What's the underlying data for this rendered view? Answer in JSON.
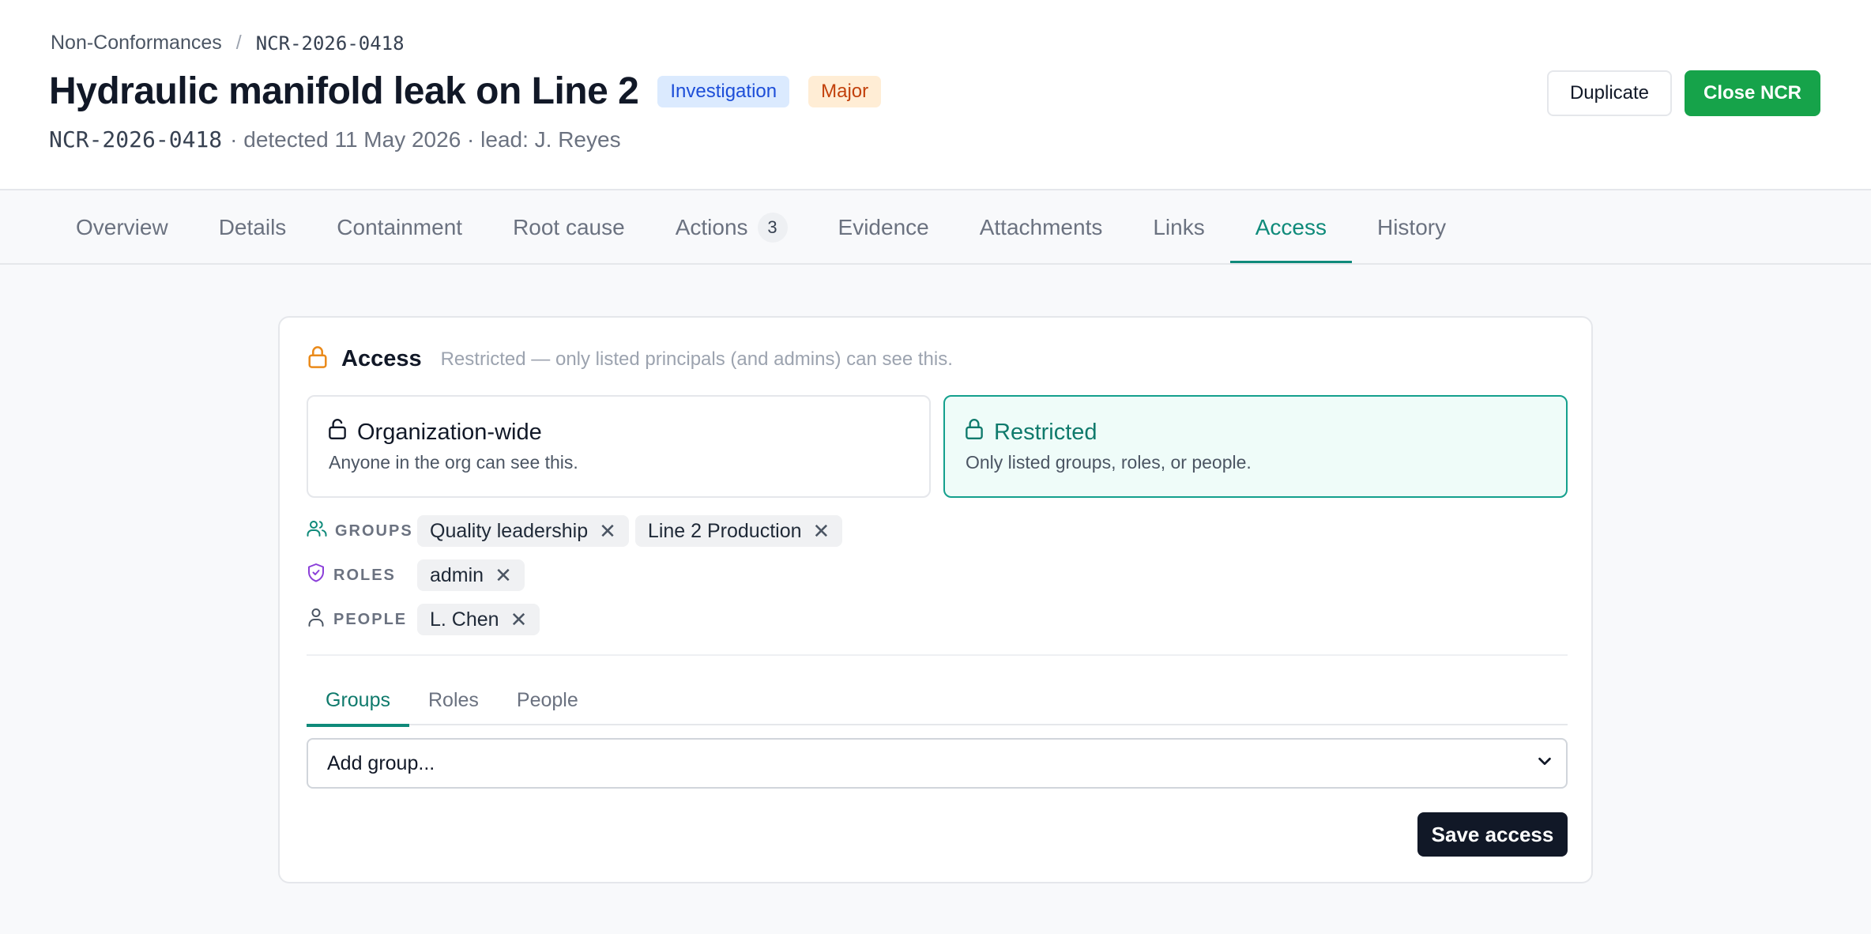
{
  "breadcrumb": {
    "parent": "Non-Conformances",
    "sep": "/",
    "current": "NCR-2026-0418"
  },
  "record": {
    "title": "Hydraulic manifold leak on Line 2",
    "status_badge": "Investigation",
    "severity_badge": "Major",
    "id": "NCR-2026-0418",
    "meta": "· detected 11 May 2026 · lead: J. Reyes"
  },
  "header_actions": {
    "duplicate": "Duplicate",
    "close": "Close NCR"
  },
  "tabs": [
    {
      "label": "Overview"
    },
    {
      "label": "Details"
    },
    {
      "label": "Containment"
    },
    {
      "label": "Root cause"
    },
    {
      "label": "Actions",
      "count": "3"
    },
    {
      "label": "Evidence"
    },
    {
      "label": "Attachments"
    },
    {
      "label": "Links"
    },
    {
      "label": "Access",
      "active": true
    },
    {
      "label": "History"
    }
  ],
  "access": {
    "title": "Access",
    "description": "Restricted — only listed principals (and admins) can see this.",
    "options": [
      {
        "title": "Organization-wide",
        "desc": "Anyone in the org can see this."
      },
      {
        "title": "Restricted",
        "desc": "Only listed groups, roles, or people.",
        "selected": true
      }
    ],
    "principals": {
      "groups_label": "GROUPS",
      "groups": [
        "Quality leadership",
        "Line 2 Production"
      ],
      "roles_label": "ROLES",
      "roles": [
        "admin"
      ],
      "people_label": "PEOPLE",
      "people": [
        "L. Chen"
      ]
    },
    "subtabs": [
      "Groups",
      "Roles",
      "People"
    ],
    "select_value": "Add group...",
    "save_label": "Save access"
  },
  "colors": {
    "accent": "#0f8a7a",
    "primary_green": "#16a34a",
    "lock_orange": "#ea8a1a",
    "role_purple": "#8b3fd9"
  },
  "icons": {
    "access": "lock-icon",
    "org": "lock-open-icon",
    "restricted": "lock-icon",
    "groups": "users-icon",
    "roles": "shield-check-icon",
    "people": "user-icon",
    "remove": "x-icon",
    "select": "chevron-down-icon"
  }
}
